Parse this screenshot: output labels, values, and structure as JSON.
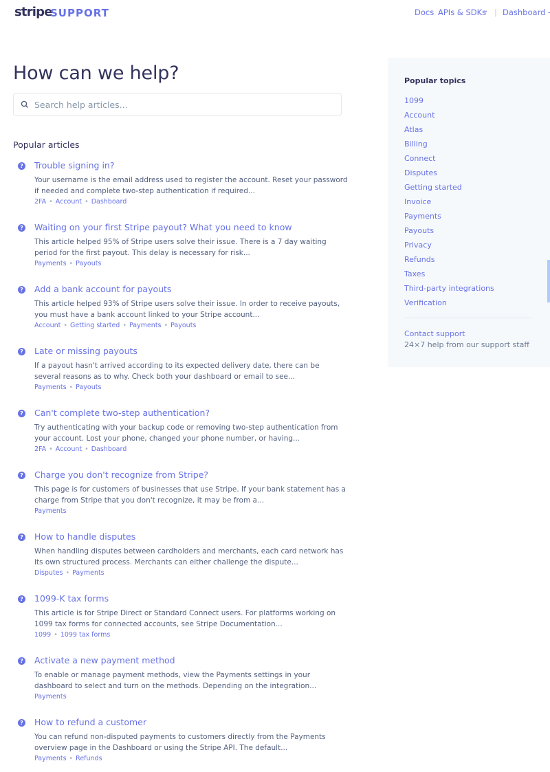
{
  "header": {
    "logo": "stripe",
    "logo_suffix": "SUPPORT",
    "nav": {
      "docs": "Docs",
      "apis": "APIs & SDKs",
      "separator": "|",
      "dashboard": "Dashboard →"
    }
  },
  "page_title": "How can we help?",
  "search": {
    "placeholder": "Search help articles..."
  },
  "popular_articles_title": "Popular articles",
  "articles": [
    {
      "title": "Trouble signing in?",
      "description": "Your username is the email address used to register the account. Reset your password if needed and complete two-step authentication if required...",
      "tags": [
        "2FA",
        "Account",
        "Dashboard"
      ]
    },
    {
      "title": "Waiting on your first Stripe payout? What you need to know",
      "description": "This article helped 95% of Stripe users solve their issue. There is a 7 day waiting period for the first payout. This delay is necessary for risk...",
      "tags": [
        "Payments",
        "Payouts"
      ]
    },
    {
      "title": "Add a bank account for payouts",
      "description": "This article helped 93% of Stripe users solve their issue. In order to receive payouts, you must have a bank account linked to your Stripe account...",
      "tags": [
        "Account",
        "Getting started",
        "Payments",
        "Payouts"
      ]
    },
    {
      "title": "Late or missing payouts",
      "description": "If a payout hasn't arrived according to its expected delivery date, there can be several reasons as to why. Check both your dashboard or email to see...",
      "tags": [
        "Payments",
        "Payouts"
      ]
    },
    {
      "title": "Can't complete two-step authentication?",
      "description": "Try authenticating with your backup code or removing two-step authentication from your account. Lost your phone, changed your phone number, or having...",
      "tags": [
        "2FA",
        "Account",
        "Dashboard"
      ]
    },
    {
      "title": "Charge you don't recognize from Stripe?",
      "description": "This page is for customers of businesses that use Stripe. If your bank statement has a charge from Stripe that you don't recognize, it may be from a...",
      "tags": [
        "Payments"
      ]
    },
    {
      "title": "How to handle disputes",
      "description": "When handling disputes between cardholders and merchants, each card network has its own structured process. Merchants can either challenge the dispute...",
      "tags": [
        "Disputes",
        "Payments"
      ]
    },
    {
      "title": "1099-K tax forms",
      "description": "This article is for Stripe Direct or Standard Connect users. For platforms working on 1099 tax forms for connected accounts, see Stripe Documentation...",
      "tags": [
        "1099",
        "1099 tax forms"
      ]
    },
    {
      "title": "Activate a new payment method",
      "description": "To enable or manage payment methods, view the Payments settings in your dashboard to select and turn on the methods. Depending on the integration...",
      "tags": [
        "Payments"
      ]
    },
    {
      "title": "How to refund a customer",
      "description": "You can refund non-disputed payments to customers directly from the Payments overview page in the Dashboard or using the Stripe API. The default...",
      "tags": [
        "Payments",
        "Refunds"
      ]
    }
  ],
  "sidebar": {
    "title": "Popular topics",
    "topics": [
      "1099",
      "Account",
      "Atlas",
      "Billing",
      "Connect",
      "Disputes",
      "Getting started",
      "Invoice",
      "Payments",
      "Payouts",
      "Privacy",
      "Refunds",
      "Taxes",
      "Third-party integrations",
      "Verification"
    ],
    "contact_link": "Contact support",
    "contact_sub": "24×7 help from our support staff"
  },
  "colors": {
    "accent": "#6772e5",
    "text": "#32325d",
    "muted": "#525f7f",
    "sidebar_bg": "#f6f9fc"
  },
  "icons": {
    "search": "search-icon",
    "article": "question-circle-icon",
    "chevron": "chevron-down-icon"
  }
}
